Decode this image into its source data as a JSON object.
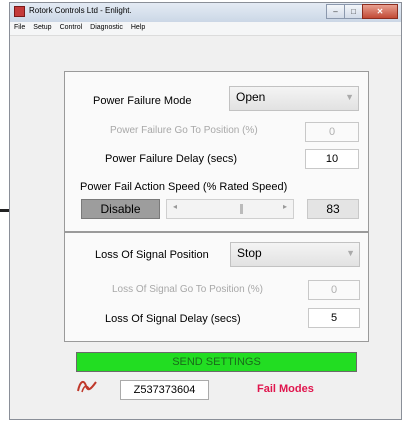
{
  "window": {
    "title": "Rotork Controls Ltd - Enlight.",
    "buttons": {
      "minimize": "–",
      "maximize": "□",
      "close": "✕"
    }
  },
  "menu": [
    "File",
    "Setup",
    "Control",
    "Diagnostic",
    "Help"
  ],
  "power_failure": {
    "mode_label": "Power Failure Mode",
    "mode_value": "Open",
    "goto_label": "Power Failure Go To Position (%)",
    "goto_value": "0",
    "delay_label": "Power Failure Delay (secs)",
    "delay_value": "10",
    "speed_label": "Power Fail Action Speed (% Rated Speed)",
    "disable_label": "Disable",
    "speed_value": "83"
  },
  "loss_of_signal": {
    "position_label": "Loss Of Signal Position",
    "position_value": "Stop",
    "goto_label": "Loss Of Signal Go To Position (%)",
    "goto_value": "0",
    "delay_label": "Loss Of Signal Delay (secs)",
    "delay_value": "5"
  },
  "footer": {
    "send_label": "SEND SETTINGS",
    "serial": "Z537373604",
    "page_label": "Fail Modes"
  },
  "colors": {
    "send_button": "#22dd22",
    "page_label": "#e0154d",
    "disable_button": "#9d9d9d"
  }
}
